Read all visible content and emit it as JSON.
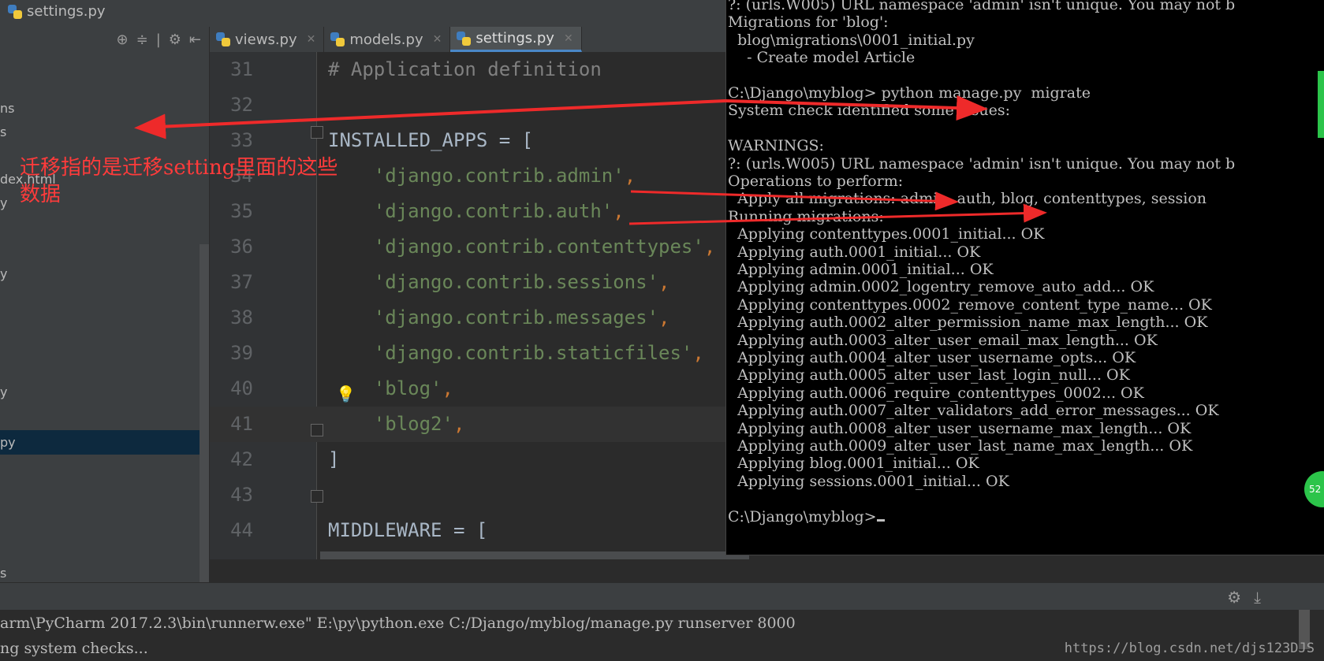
{
  "breadcrumb": {
    "file": "settings.py"
  },
  "sidebar": {
    "items": [
      "ns",
      "s",
      "",
      "dex.html",
      "y",
      "",
      "y",
      "y",
      "py",
      "s"
    ],
    "selected_index": 8
  },
  "tabs": [
    {
      "label": "views.py",
      "active": false
    },
    {
      "label": "models.py",
      "active": false
    },
    {
      "label": "settings.py",
      "active": true
    }
  ],
  "editor": {
    "lines": [
      {
        "num": "31",
        "text": "# Application definition",
        "kind": "comment"
      },
      {
        "num": "32",
        "text": "",
        "kind": "ident"
      },
      {
        "num": "33",
        "text": "INSTALLED_APPS = [",
        "kind": "ident"
      },
      {
        "num": "34",
        "text": "    'django.contrib.admin',",
        "kind": "str"
      },
      {
        "num": "35",
        "text": "    'django.contrib.auth',",
        "kind": "str"
      },
      {
        "num": "36",
        "text": "    'django.contrib.contenttypes',",
        "kind": "str"
      },
      {
        "num": "37",
        "text": "    'django.contrib.sessions',",
        "kind": "str"
      },
      {
        "num": "38",
        "text": "    'django.contrib.messages',",
        "kind": "str"
      },
      {
        "num": "39",
        "text": "    'django.contrib.staticfiles',",
        "kind": "str"
      },
      {
        "num": "40",
        "text": "    'blog',",
        "kind": "str"
      },
      {
        "num": "41",
        "text": "    'blog2',",
        "kind": "str"
      },
      {
        "num": "42",
        "text": "]",
        "kind": "ident"
      },
      {
        "num": "43",
        "text": "",
        "kind": "ident"
      },
      {
        "num": "44",
        "text": "MIDDLEWARE = [",
        "kind": "ident"
      }
    ]
  },
  "terminal": {
    "lines": [
      "?: (urls.W005) URL namespace 'admin' isn't unique. You may not b",
      "Migrations for 'blog':",
      "  blog\\migrations\\0001_initial.py",
      "    - Create model Article",
      "",
      "C:\\Django\\myblog> python manage.py  migrate",
      "System check identified some issues:",
      "",
      "WARNINGS:",
      "?: (urls.W005) URL namespace 'admin' isn't unique. You may not b",
      "Operations to perform:",
      "  Apply all migrations: admin, auth, blog, contenttypes, session",
      "Running migrations:",
      "  Applying contenttypes.0001_initial... OK",
      "  Applying auth.0001_initial... OK",
      "  Applying admin.0001_initial... OK",
      "  Applying admin.0002_logentry_remove_auto_add... OK",
      "  Applying contenttypes.0002_remove_content_type_name... OK",
      "  Applying auth.0002_alter_permission_name_max_length... OK",
      "  Applying auth.0003_alter_user_email_max_length... OK",
      "  Applying auth.0004_alter_user_username_opts... OK",
      "  Applying auth.0005_alter_user_last_login_null... OK",
      "  Applying auth.0006_require_contenttypes_0002... OK",
      "  Applying auth.0007_alter_validators_add_error_messages... OK",
      "  Applying auth.0008_alter_user_username_max_length... OK",
      "  Applying auth.0009_alter_user_last_name_max_length... OK",
      "  Applying blog.0001_initial... OK",
      "  Applying sessions.0001_initial... OK",
      "",
      "C:\\Django\\myblog>"
    ]
  },
  "console": {
    "lines": [
      "arm\\PyCharm 2017.2.3\\bin\\runnerw.exe\" E:\\py\\python.exe C:/Django/myblog/manage.py runserver 8000",
      "ng system checks..."
    ]
  },
  "annotation": {
    "line1": "迁移指的是迁移setting里面的这些",
    "line2": "数据",
    "color": "#ff3b3b"
  },
  "watermark": "https://blog.csdn.net/djs123DJS",
  "colors": {
    "comment": "#808080",
    "string": "#6a8759",
    "identifier": "#a9b7c6",
    "arrow": "#ee2a2a"
  }
}
